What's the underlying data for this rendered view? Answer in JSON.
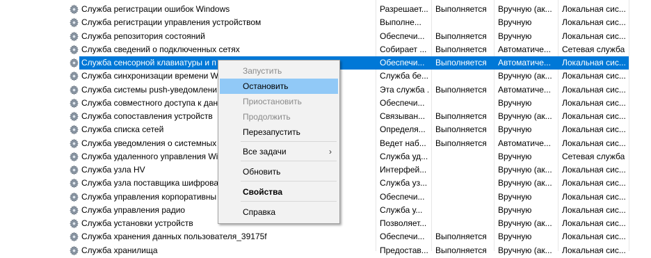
{
  "services": [
    {
      "name": "Служба регистрации ошибок Windows",
      "desc": "Разрешает...",
      "status": "Выполняется",
      "startup": "Вручную (ак...",
      "logon": "Локальная сис..."
    },
    {
      "name": "Служба регистрации управления устройством",
      "desc": "Выполне...",
      "status": "",
      "startup": "Вручную",
      "logon": "Локальная сис..."
    },
    {
      "name": "Служба репозитория состояний",
      "desc": "Обеспечи...",
      "status": "Выполняется",
      "startup": "Вручную",
      "logon": "Локальная сис..."
    },
    {
      "name": "Служба сведений о подключенных сетях",
      "desc": "Собирает ...",
      "status": "Выполняется",
      "startup": "Автоматиче...",
      "logon": "Сетевая служба"
    },
    {
      "name": "Служба сенсорной клавиатуры и п",
      "desc": "Обеспечи...",
      "status": "Выполняется",
      "startup": "Автоматиче...",
      "logon": "Локальная сис...",
      "selected": true
    },
    {
      "name": "Служба синхронизации времени Wi",
      "desc": "Служба бе...",
      "status": "",
      "startup": "Вручную (ак...",
      "logon": "Локальная сис..."
    },
    {
      "name": "Служба системы push-уведомлени",
      "desc": "Эта служба ...",
      "status": "Выполняется",
      "startup": "Автоматиче...",
      "logon": "Локальная сис..."
    },
    {
      "name": "Служба совместного доступа к дан",
      "desc": "Обеспечи...",
      "status": "",
      "startup": "Вручную",
      "logon": "Локальная сис..."
    },
    {
      "name": "Служба сопоставления устройств",
      "desc": "Связыван...",
      "status": "Выполняется",
      "startup": "Вручную (ак...",
      "logon": "Локальная сис..."
    },
    {
      "name": "Служба списка сетей",
      "desc": "Определя...",
      "status": "Выполняется",
      "startup": "Вручную",
      "logon": "Локальная сис..."
    },
    {
      "name": "Служба уведомления о системных",
      "desc": "Ведет наб...",
      "status": "Выполняется",
      "startup": "Автоматиче...",
      "logon": "Локальная сис..."
    },
    {
      "name": "Служба удаленного управления Wi",
      "desc": "Служба уд...",
      "status": "",
      "startup": "Вручную",
      "logon": "Сетевая служба"
    },
    {
      "name": "Служба узла HV",
      "desc": "Интерфей...",
      "status": "",
      "startup": "Вручную (ак...",
      "logon": "Локальная сис..."
    },
    {
      "name": "Служба узла поставщика шифрова",
      "desc": "Служба уз...",
      "status": "",
      "startup": "Вручную (ак...",
      "logon": "Локальная сис..."
    },
    {
      "name": "Служба управления корпоративны",
      "desc": "Обеспечи...",
      "status": "",
      "startup": "Вручную",
      "logon": "Локальная сис..."
    },
    {
      "name": "Служба управления радио",
      "desc": "Служба у...",
      "status": "",
      "startup": "Вручную",
      "logon": "Локальная сис..."
    },
    {
      "name": "Служба установки устройств",
      "desc": "Позволяет...",
      "status": "",
      "startup": "Вручную (ак...",
      "logon": "Локальная сис..."
    },
    {
      "name": "Служба хранения данных пользователя_39175f",
      "desc": "Обеспечи...",
      "status": "Выполняется",
      "startup": "Вручную",
      "logon": "Локальная сис..."
    },
    {
      "name": "Служба хранилища",
      "desc": "Предостав...",
      "status": "Выполняется",
      "startup": "Вручную (ак...",
      "logon": "Локальная сис..."
    }
  ],
  "context_menu": {
    "start": "Запустить",
    "stop": "Остановить",
    "pause": "Приостановить",
    "resume": "Продолжить",
    "restart": "Перезапустить",
    "all_tasks": "Все задачи",
    "refresh": "Обновить",
    "properties": "Свойства",
    "help": "Справка"
  },
  "colors": {
    "selection": "#0078d7",
    "menu_highlight": "#91c9f7",
    "disabled_text": "#8a8a8a"
  },
  "icons": {
    "service": "gear-icon",
    "submenu": "chevron-right-icon"
  }
}
